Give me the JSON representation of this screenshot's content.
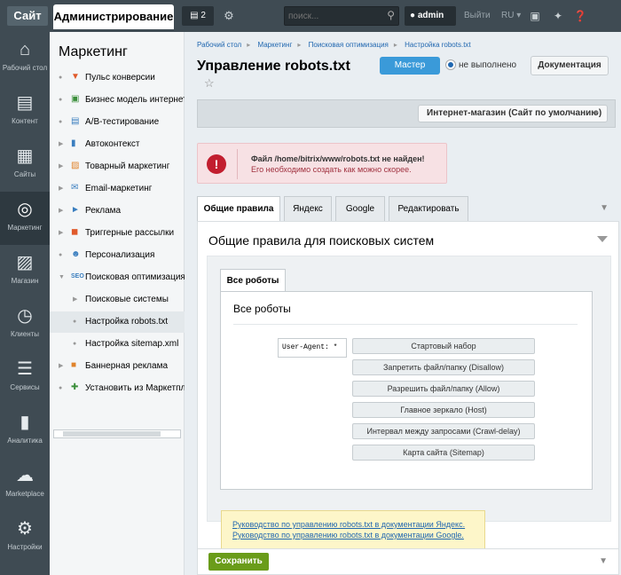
{
  "topbar": {
    "site": "Сайт",
    "admin": "Администрирование",
    "notif_count": "2",
    "search_placeholder": "поиск...",
    "user": "admin",
    "exit": "Выйти",
    "lang": "RU"
  },
  "leftmenu": [
    {
      "label": "Рабочий стол",
      "icon": "home-icon"
    },
    {
      "label": "Контент",
      "icon": "document-icon"
    },
    {
      "label": "Сайты",
      "icon": "calendar-icon"
    },
    {
      "label": "Маркетинг",
      "icon": "target-icon"
    },
    {
      "label": "Магазин",
      "icon": "basket-icon"
    },
    {
      "label": "Клиенты",
      "icon": "clock-icon"
    },
    {
      "label": "Сервисы",
      "icon": "layers-icon"
    },
    {
      "label": "Аналитика",
      "icon": "chart-icon"
    },
    {
      "label": "Marketplace",
      "icon": "cloud-icon"
    },
    {
      "label": "Настройки",
      "icon": "gear-icon"
    }
  ],
  "submenu": {
    "title": "Маркетинг",
    "items": [
      {
        "label": "Пульс конверсии"
      },
      {
        "label": "Бизнес модель интернет-магазина"
      },
      {
        "label": "A/B-тестирование"
      },
      {
        "label": "Автоконтекст"
      },
      {
        "label": "Товарный маркетинг"
      },
      {
        "label": "Email-маркетинг"
      },
      {
        "label": "Реклама"
      },
      {
        "label": "Триггерные рассылки"
      },
      {
        "label": "Персонализация"
      },
      {
        "label": "Поисковая оптимизация"
      },
      {
        "label": "Поисковые системы"
      },
      {
        "label": "Настройка robots.txt"
      },
      {
        "label": "Настройка sitemap.xml"
      },
      {
        "label": "Баннерная реклама"
      },
      {
        "label": "Установить из Маркетплейс"
      }
    ]
  },
  "breadcrumb": [
    "Рабочий стол",
    "Маркетинг",
    "Поисковая оптимизация",
    "Настройка robots.txt"
  ],
  "page": {
    "title": "Управление robots.txt",
    "master": "Мастер",
    "status": "не выполнено",
    "docs": "Документация",
    "site_select": "Интернет-магазин (Сайт по умолчанию)"
  },
  "error": {
    "title": "Файл /home/bitrix/www/robots.txt не найден!",
    "text": "Его необходимо создать как можно скорее."
  },
  "tabs": [
    "Общие правила",
    "Яндекс",
    "Google",
    "Редактировать"
  ],
  "panel": {
    "title": "Общие правила для поисковых систем",
    "inner_tab": "Все роботы",
    "inner_title": "Все роботы",
    "user_agent": "User-Agent: *",
    "buttons": [
      "Стартовый набор",
      "Запретить файл/папку (Disallow)",
      "Разрешить файл/папку (Allow)",
      "Главное зеркало (Host)",
      "Интервал между запросами (Crawl-delay)",
      "Карта сайта (Sitemap)"
    ],
    "links": [
      "Руководство по управлению robots.txt в документации Яндекс.",
      "Руководство по управлению robots.txt в документации Google."
    ]
  },
  "footer": {
    "save": "Сохранить"
  },
  "colors": {
    "topbar": "#3f4b53",
    "accent": "#3a9ad9",
    "save": "#6a9c1a",
    "error": "#c21e2f"
  }
}
